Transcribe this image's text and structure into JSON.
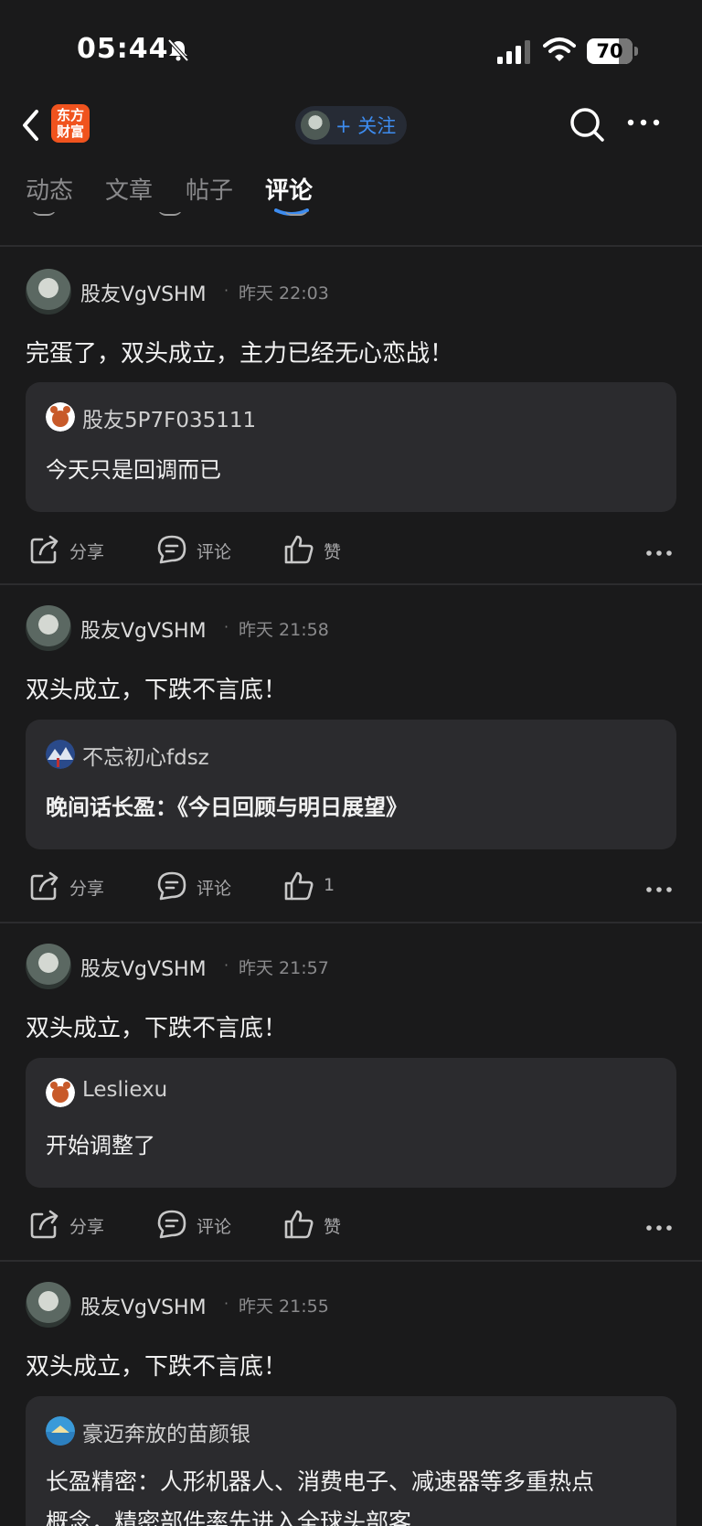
{
  "status_bar": {
    "time": "05:44",
    "battery": "70",
    "icons": [
      "bell-muted-icon",
      "signal-icon",
      "wifi-icon",
      "battery-icon"
    ]
  },
  "nav": {
    "logo_line1": "东方",
    "logo_line2": "财富",
    "follow_label": "+ 关注",
    "icons": [
      "back-icon",
      "search-icon",
      "more-icon"
    ],
    "accent_color": "#3d8cf0",
    "logo_color": "#f0531e"
  },
  "tabs": [
    {
      "label": "动态"
    },
    {
      "label": "文章"
    },
    {
      "label": "帖子"
    },
    {
      "label": "评论",
      "active": true
    }
  ],
  "actions": {
    "share": "分享",
    "comment": "评论",
    "like": "赞"
  },
  "posts": [
    {
      "username": "股友VgVSHM",
      "dot": "·",
      "time": "昨天 22:03",
      "body": "完蛋了，双头成立，主力已经无心恋战！",
      "quote_user": "股友5P7F035111",
      "quote_text": "今天只是回调而已",
      "likes": "赞"
    },
    {
      "username": "股友VgVSHM",
      "dot": "·",
      "time": "昨天 21:58",
      "body": "双头成立，下跌不言底！",
      "quote_user": "不忘初心fdsz",
      "quote_text": "晚间话长盈：《今日回顾与明日展望》",
      "likes": "1"
    },
    {
      "username": "股友VgVSHM",
      "dot": "·",
      "time": "昨天 21:57",
      "body": "双头成立，下跌不言底！",
      "quote_user": "Lesliexu",
      "quote_text": "开始调整了",
      "likes": "赞"
    },
    {
      "username": "股友VgVSHM",
      "dot": "·",
      "time": "昨天 21:55",
      "body": "双头成立，下跌不言底！",
      "quote_user": "豪迈奔放的苗颜银",
      "quote_text": "长盈精密：人形机器人、消费电子、减速器等多重热点",
      "quote_text2": "概念，精密部件率先进入全球头部客"
    }
  ]
}
